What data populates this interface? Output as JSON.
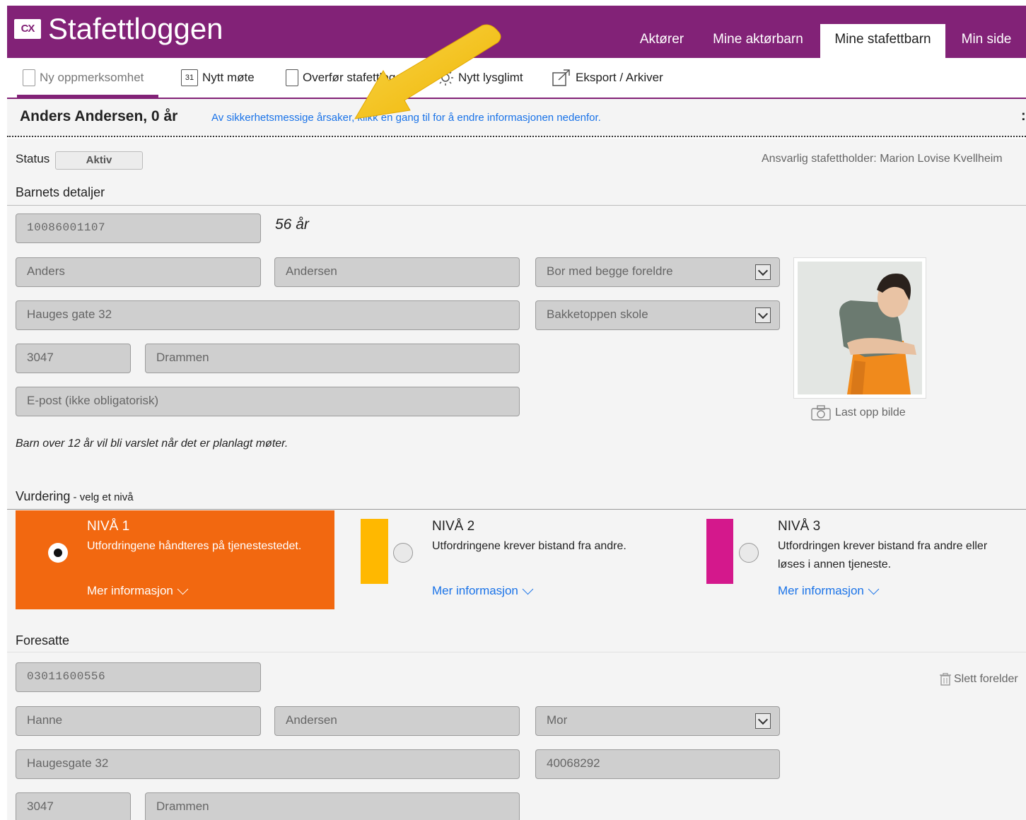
{
  "app": {
    "logo": "CX",
    "title": "Stafettloggen"
  },
  "nav": [
    {
      "label": "Aktører"
    },
    {
      "label": "Mine aktørbarn"
    },
    {
      "label": "Mine stafettbarn"
    },
    {
      "label": "Min side"
    }
  ],
  "toolbar": {
    "new_concern": "Ny oppmerksomhet",
    "new_meeting": "Nytt møte",
    "transfer": "Overfør stafettlogg",
    "new_glimpse": "Nytt lysglimt",
    "export": "Eksport / Arkiver",
    "calendar_day": "31"
  },
  "child": {
    "title": "Anders Andersen, 0 år",
    "security_msg": "Av sikkerhetsmessige årsaker, klikk en gang til for å endre informasjonen nedenfor.",
    "more_marker": ":"
  },
  "status": {
    "label": "Status",
    "value": "Aktiv",
    "responsible": "Ansvarlig stafettholder: Marion Lovise Kvellheim"
  },
  "child_details": {
    "heading": "Barnets detaljer",
    "ssn": "10086001107",
    "age_text": "56 år",
    "first_name": "Anders",
    "last_name": "Andersen",
    "living": "Bor med begge foreldre",
    "address": "Hauges gate 32",
    "school": "Bakketoppen skole",
    "zip": "3047",
    "city": "Drammen",
    "email_placeholder": "E-post (ikke obligatorisk)",
    "upload_photo": "Last opp bilde",
    "notice": "Barn over 12 år vil bli varslet når det er planlagt møter."
  },
  "assessment": {
    "heading": "Vurdering",
    "subheading": " - velg et nivå",
    "selected_level": 1,
    "levels": [
      {
        "title": "NIVÅ 1",
        "desc": "Utfordringene håndteres på tjenestestedet.",
        "more": "Mer informasjon",
        "color": "#f26810"
      },
      {
        "title": "NIVÅ 2",
        "desc": "Utfordringene krever bistand fra andre.",
        "more": "Mer informasjon",
        "color": "#ffb800"
      },
      {
        "title": "NIVÅ 3",
        "desc": "Utfordringen krever bistand fra andre eller",
        "desc2": "løses i annen tjeneste.",
        "more": "Mer informasjon",
        "color": "#d4188c"
      }
    ]
  },
  "guardians": {
    "heading": "Foresatte",
    "delete": "Slett forelder",
    "ssn": "03011600556",
    "first_name": "Hanne",
    "last_name": "Andersen",
    "relation": "Mor",
    "address": "Haugesgate 32",
    "phone": "40068292",
    "zip": "3047",
    "city": "Drammen"
  },
  "colors": {
    "brand": "#822277",
    "link": "#1a73e8",
    "annotation_arrow": "#f5c518"
  }
}
